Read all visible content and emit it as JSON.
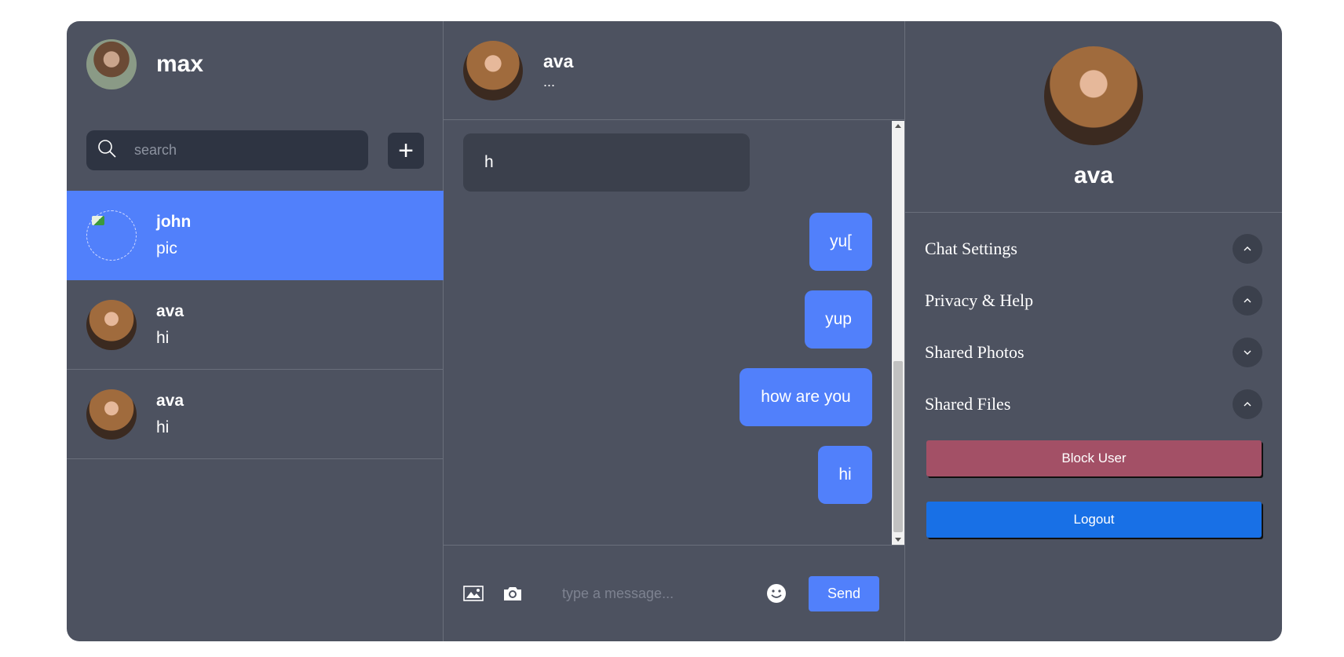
{
  "current_user": {
    "name": "max"
  },
  "search": {
    "placeholder": "search"
  },
  "add_button": {
    "label": "+"
  },
  "conversations": [
    {
      "name": "john",
      "last_message": "pic"
    },
    {
      "name": "ava",
      "last_message": "hi"
    },
    {
      "name": "ava",
      "last_message": "hi"
    }
  ],
  "chat": {
    "contact_name": "ava",
    "status": "...",
    "messages": [
      {
        "direction": "in",
        "text": "h"
      },
      {
        "direction": "out",
        "text": "yu["
      },
      {
        "direction": "out",
        "text": "yup"
      },
      {
        "direction": "out",
        "text": "how are you"
      },
      {
        "direction": "out",
        "text": "hi"
      }
    ]
  },
  "composer": {
    "placeholder": "type a message...",
    "send_label": "Send",
    "icons": [
      "image-icon",
      "camera-icon",
      "emoji-icon"
    ]
  },
  "profile": {
    "name": "ava",
    "sections": [
      {
        "label": "Chat Settings",
        "state": "expanded"
      },
      {
        "label": "Privacy & Help",
        "state": "expanded"
      },
      {
        "label": "Shared Photos",
        "state": "collapsed"
      },
      {
        "label": "Shared Files",
        "state": "expanded"
      }
    ],
    "block_label": "Block User",
    "logout_label": "Logout"
  },
  "colors": {
    "panel_bg": "#4d5260",
    "accent_blue": "#5180fb",
    "dark_input": "#2e3442",
    "block_red": "#a35066",
    "logout_blue": "#1870e6"
  }
}
